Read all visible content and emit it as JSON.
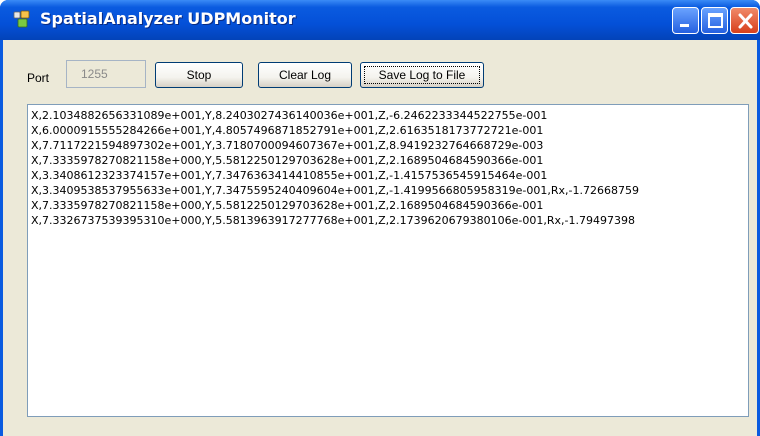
{
  "window": {
    "title": "SpatialAnalyzer UDPMonitor"
  },
  "controls": {
    "port_label": "Port",
    "port_value": "1255",
    "stop_label": "Stop",
    "clear_log_label": "Clear Log",
    "save_log_label": "Save Log to File"
  },
  "log": {
    "lines": [
      "X,2.1034882656331089e+001,Y,8.2403027436140036e+001,Z,-6.2462233344522755e-001",
      "X,6.0000915555284266e+001,Y,4.8057496871852791e+001,Z,2.6163518173772721e-001",
      "X,7.7117221594897302e+001,Y,3.7180700094607367e+001,Z,8.9419232764668729e-003",
      "X,7.3335978270821158e+000,Y,5.5812250129703628e+001,Z,2.1689504684590366e-001",
      "X,3.3408612323374157e+001,Y,7.3476363414410855e+001,Z,-1.4157536545915464e-001",
      "X,3.3409538537955633e+001,Y,7.3475595240409604e+001,Z,-1.4199566805958319e-001,Rx,-1.72668759",
      "X,7.3335978270821158e+000,Y,5.5812250129703628e+001,Z,2.1689504684590366e-001",
      "X,7.3326737539395310e+000,Y,5.5813963917277768e+001,Z,2.1739620679380106e-001,Rx,-1.79497398"
    ]
  },
  "icons": {
    "app": "app-icon",
    "minimize": "minimize-icon",
    "maximize": "maximize-icon",
    "close": "close-icon"
  }
}
